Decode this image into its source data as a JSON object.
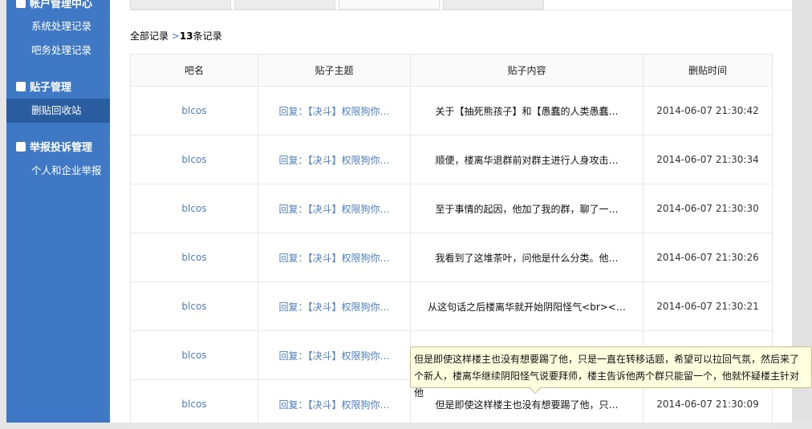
{
  "sidebar": {
    "sections": [
      {
        "label": "帐户管理中心",
        "icon": "user-icon",
        "items": [
          "系统处理记录",
          "吧务处理记录"
        ]
      },
      {
        "label": "贴子管理",
        "icon": "document-icon",
        "items": [
          "删贴回收站"
        ]
      },
      {
        "label": "举报投诉管理",
        "icon": "users-icon",
        "items": [
          "个人和企业举报"
        ]
      }
    ],
    "active_item": "删贴回收站"
  },
  "breadcrumb": {
    "root": "全部记录",
    "sep": " >",
    "count": "13",
    "suffix": "条记录"
  },
  "table": {
    "headers": [
      "吧名",
      "贴子主题",
      "贴子内容",
      "删贴时间"
    ],
    "rows": [
      {
        "bar": "blcos",
        "topic": "回复：【决斗】权限狗你…",
        "content": "关于【抽死熊孩子】和【愚蠢的人类愚蠢…",
        "time": "2014-06-07 21:30:42"
      },
      {
        "bar": "blcos",
        "topic": "回复：【决斗】权限狗你…",
        "content": "顺便，楼离华退群前对群主进行人身攻击…",
        "time": "2014-06-07 21:30:34"
      },
      {
        "bar": "blcos",
        "topic": "回复：【决斗】权限狗你…",
        "content": "至于事情的起因，他加了我的群，聊了一…",
        "time": "2014-06-07 21:30:30"
      },
      {
        "bar": "blcos",
        "topic": "回复：【决斗】权限狗你…",
        "content": "我看到了这堆茶叶，问他是什么分类。他…",
        "time": "2014-06-07 21:30:26"
      },
      {
        "bar": "blcos",
        "topic": "回复：【决斗】权限狗你…",
        "content": "从这句话之后楼离华就开始阴阳怪气<br><…",
        "time": "2014-06-07 21:30:21"
      },
      {
        "bar": "blcos",
        "topic": "回复：【决斗】权限狗你…",
        "content": "",
        "time": ""
      },
      {
        "bar": "blcos",
        "topic": "回复：【决斗】权限狗你…",
        "content": "但是即使这样楼主也没有想要踢了他，只…",
        "time": "2014-06-07 21:30:09"
      }
    ]
  },
  "tooltip": {
    "text": "但是即使这样楼主也没有想要踢了他，只是一直在转移话题，希望可以拉回气氛，然后来了个新人，楼离华继续阴阳怪气说要拜师，楼主告诉他两个群只能留一个，他就怀疑楼主针对他"
  }
}
